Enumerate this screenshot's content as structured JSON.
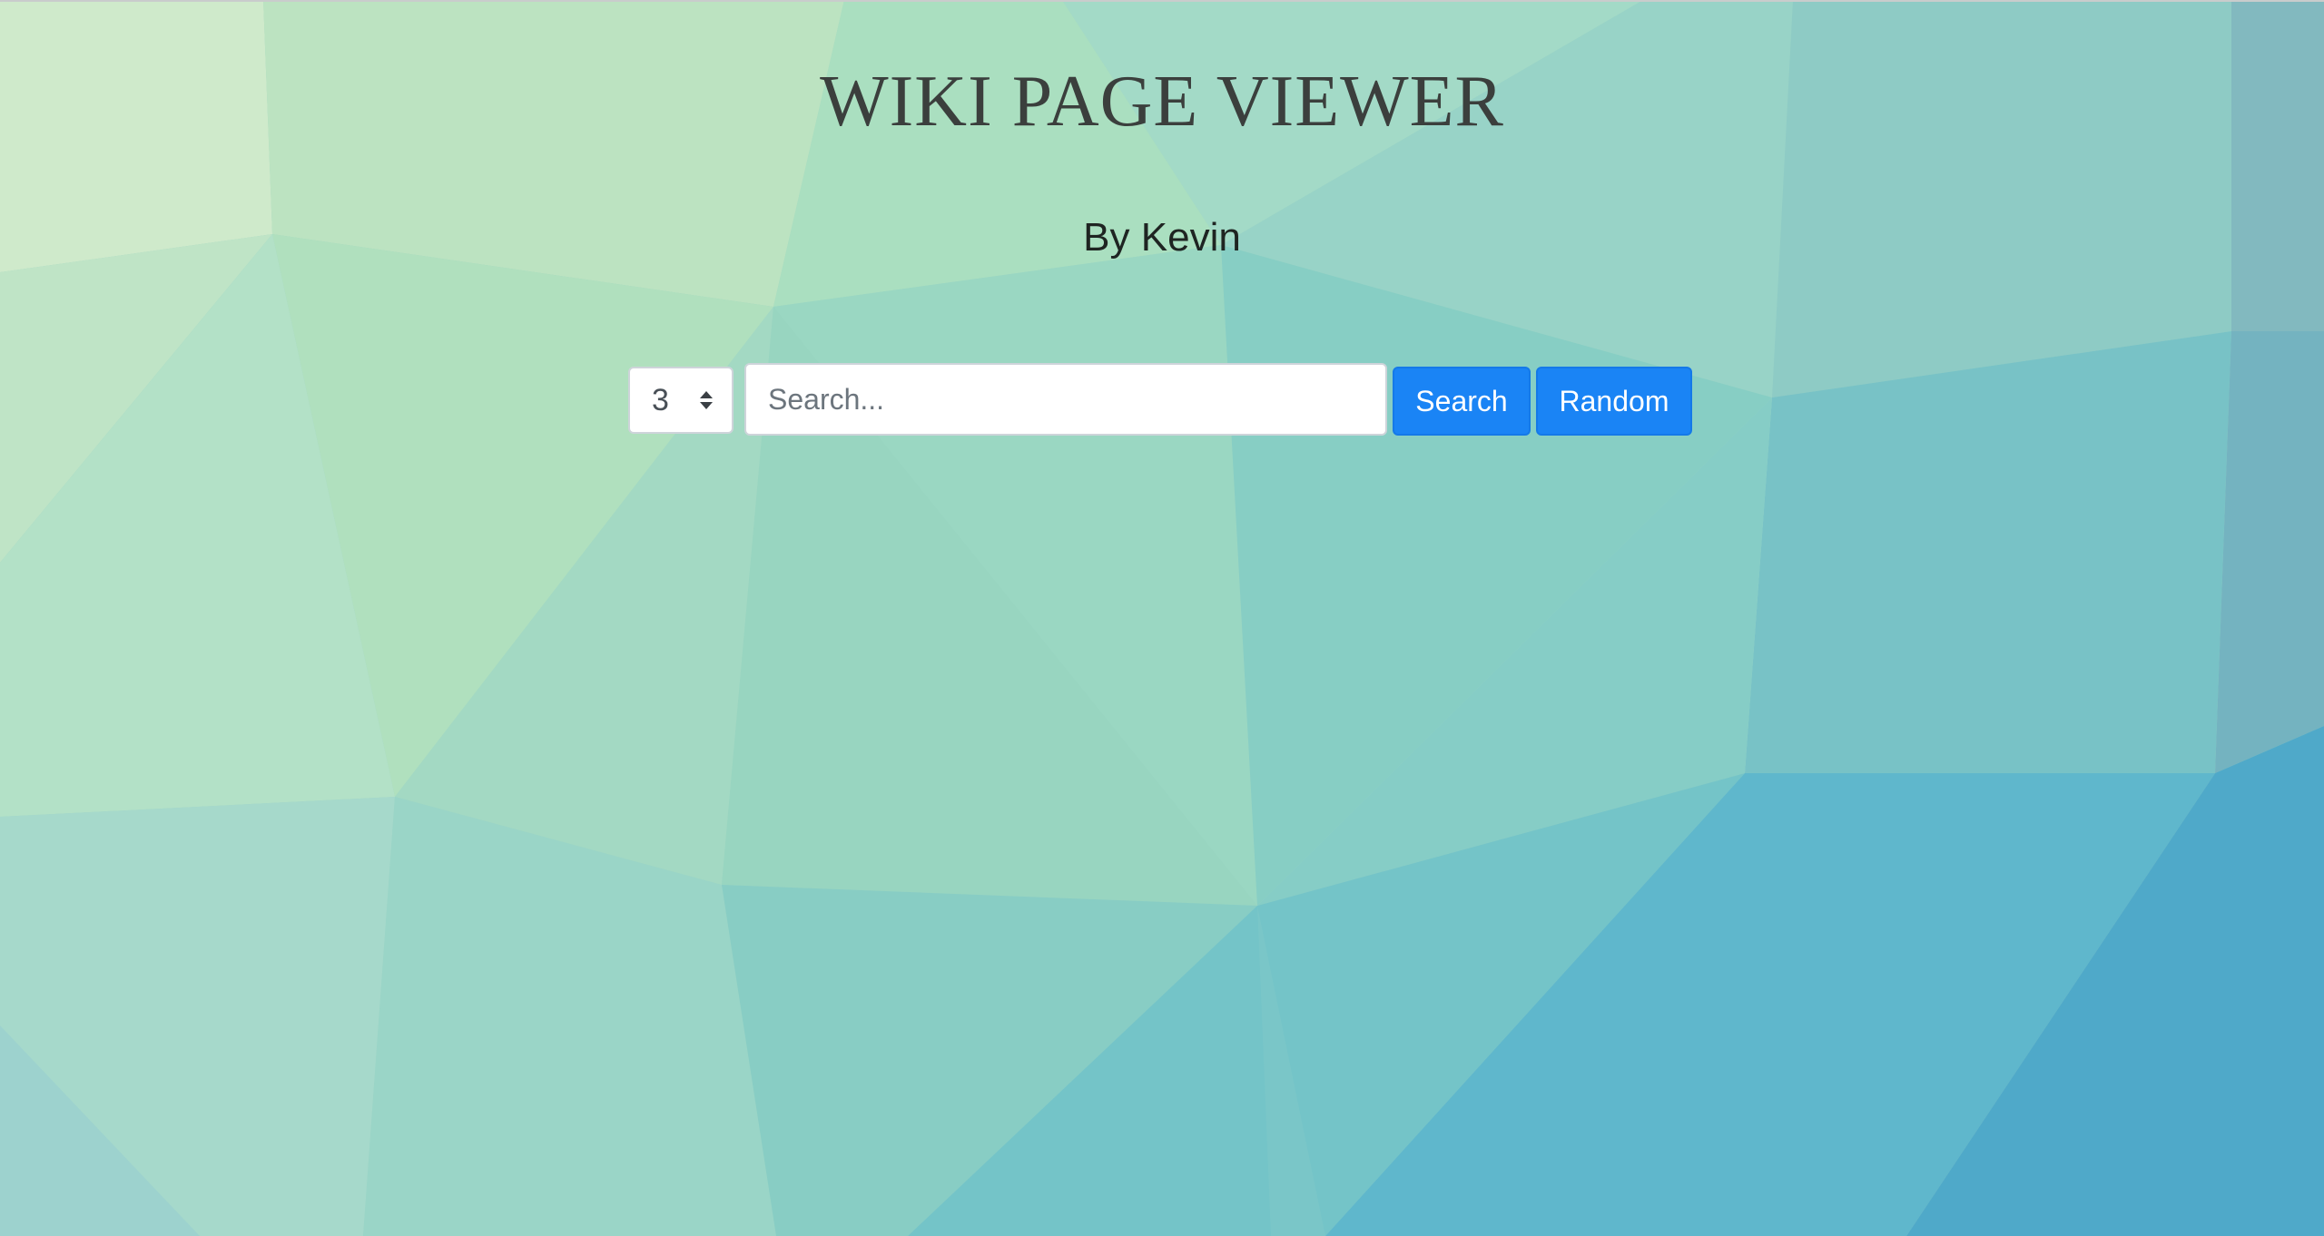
{
  "header": {
    "title": "WIKI PAGE VIEWER",
    "byline": "By Kevin"
  },
  "search": {
    "count_value": "3",
    "placeholder": "Search...",
    "value": "",
    "search_label": "Search",
    "random_label": "Random"
  },
  "theme": {
    "button_color": "#1a84f5",
    "title_color": "#3b3f3d"
  }
}
